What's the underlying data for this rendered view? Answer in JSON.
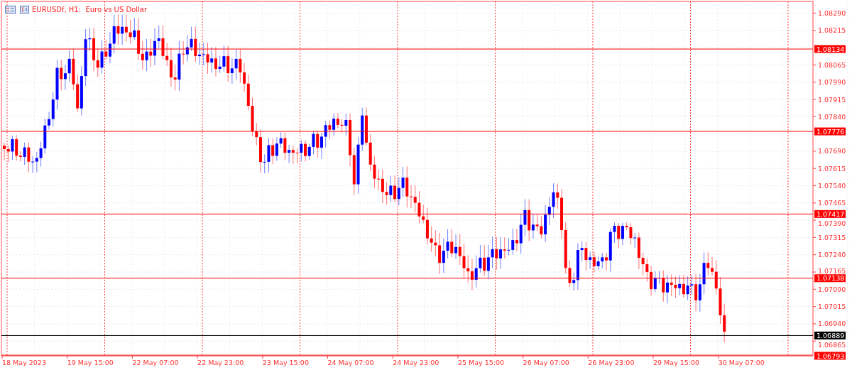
{
  "chart": {
    "title": "EURUSDf, H1:  Euro vs US Dollar"
  },
  "price_axis": [
    "1.08290",
    "1.08215",
    "1.08065",
    "1.07990",
    "1.07915",
    "1.07840",
    "1.07690",
    "1.07615",
    "1.07540",
    "1.07465",
    "1.07390",
    "1.07315",
    "1.07240",
    "1.07165",
    "1.07090",
    "1.07015",
    "1.06940",
    "1.06865"
  ],
  "levels": [
    {
      "price": "1.08134",
      "color": "#ff0000"
    },
    {
      "price": "1.07776",
      "color": "#ff0000"
    },
    {
      "price": "1.07417",
      "color": "#ff0000"
    },
    {
      "price": "1.07138",
      "color": "#ff0000"
    },
    {
      "price": "1.06889",
      "color": "#000000"
    },
    {
      "price": "1.06793",
      "color": "#ff0000"
    }
  ],
  "time_axis": [
    "18 May 2023",
    "19 May 15:00",
    "22 May 07:00",
    "22 May 23:00",
    "23 May 15:00",
    "24 May 07:00",
    "24 May 23:00",
    "25 May 15:00",
    "26 May 07:00",
    "26 May 23:00",
    "29 May 15:00",
    "30 May 07:00"
  ]
}
